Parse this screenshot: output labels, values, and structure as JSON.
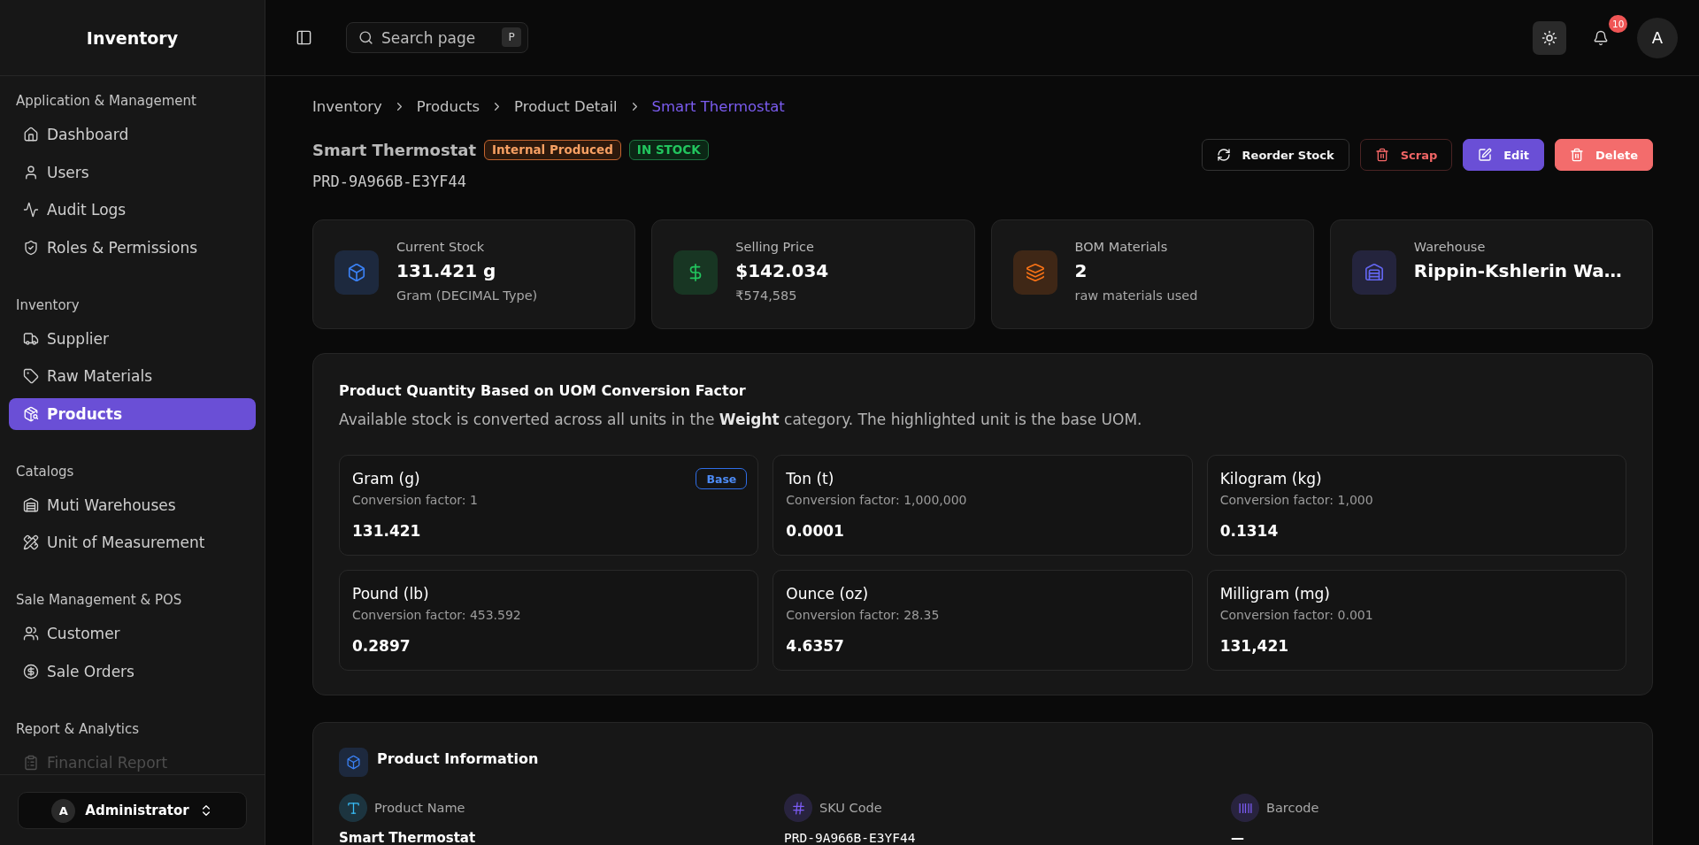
{
  "sidebar": {
    "title": "Inventory",
    "sections": [
      {
        "label": "Application & Management",
        "items": [
          {
            "label": "Dashboard",
            "selected": false,
            "disabled": false
          },
          {
            "label": "Users",
            "selected": false,
            "disabled": false
          },
          {
            "label": "Audit Logs",
            "selected": false,
            "disabled": false
          },
          {
            "label": "Roles & Permissions",
            "selected": false,
            "disabled": false
          }
        ]
      },
      {
        "label": "Inventory",
        "items": [
          {
            "label": "Supplier",
            "selected": false,
            "disabled": false
          },
          {
            "label": "Raw Materials",
            "selected": false,
            "disabled": false
          },
          {
            "label": "Products",
            "selected": true,
            "disabled": false
          }
        ]
      },
      {
        "label": "Catalogs",
        "items": [
          {
            "label": "Muti Warehouses",
            "selected": false,
            "disabled": false
          },
          {
            "label": "Unit of Measurement",
            "selected": false,
            "disabled": false
          }
        ]
      },
      {
        "label": "Sale Management & POS",
        "items": [
          {
            "label": "Customer",
            "selected": false,
            "disabled": false
          },
          {
            "label": "Sale Orders",
            "selected": false,
            "disabled": false
          }
        ]
      },
      {
        "label": "Report & Analytics",
        "items": [
          {
            "label": "Financial Report",
            "selected": false,
            "disabled": true
          }
        ]
      }
    ],
    "user": {
      "avatar": "A",
      "name": "Administrator"
    }
  },
  "topbar": {
    "search": {
      "placeholder": "Search page",
      "shortcut": "P"
    },
    "notification_count": "10",
    "avatar": "A"
  },
  "breadcrumb": [
    {
      "label": "Inventory",
      "current": false
    },
    {
      "label": "Products",
      "current": false
    },
    {
      "label": "Product Detail",
      "current": false
    },
    {
      "label": "Smart Thermostat",
      "current": true
    }
  ],
  "product": {
    "name": "Smart Thermostat",
    "badges": [
      {
        "label": "Internal Produced",
        "kind": "warning"
      },
      {
        "label": "IN STOCK",
        "kind": "success"
      }
    ],
    "sku": "PRD-9A966B-E3YF44"
  },
  "actions": [
    {
      "label": "Reorder Stock",
      "kind": "outline"
    },
    {
      "label": "Scrap",
      "kind": "danger-outline"
    },
    {
      "label": "Edit",
      "kind": "primary"
    },
    {
      "label": "Delete",
      "kind": "danger"
    }
  ],
  "stats": [
    {
      "label": "Current Stock",
      "value": "131.421 g",
      "sub": "Gram (DECIMAL Type)",
      "color": "#3b82f6"
    },
    {
      "label": "Selling Price",
      "value": "$142.034",
      "sub": "₹574,585",
      "color": "#22c55e"
    },
    {
      "label": "BOM Materials",
      "value": "2",
      "sub": "raw materials used",
      "color": "#f97316"
    },
    {
      "label": "Warehouse",
      "value": "Rippin-Kshlerin Wa…",
      "color": "#6366f1"
    }
  ],
  "uom": {
    "title": "Product Quantity Based on UOM Conversion Factor",
    "description": "Available stock is converted across all units in the **Weight** category. The highlighted unit is the base UOM.",
    "base_label": "Base",
    "units": [
      {
        "name": "Gram (g)",
        "factor": "Conversion factor: 1",
        "value": "131.421",
        "base": true
      },
      {
        "name": "Ton (t)",
        "factor": "Conversion factor: 1,000,000",
        "value": "0.0001",
        "base": false
      },
      {
        "name": "Kilogram (kg)",
        "factor": "Conversion factor: 1,000",
        "value": "0.1314",
        "base": false
      },
      {
        "name": "Pound (lb)",
        "factor": "Conversion factor: 453.592",
        "value": "0.2897",
        "base": false
      },
      {
        "name": "Ounce (oz)",
        "factor": "Conversion factor: 28.35",
        "value": "4.6357",
        "base": false
      },
      {
        "name": "Milligram (mg)",
        "factor": "Conversion factor: 0.001",
        "value": "131,421",
        "base": false
      }
    ]
  },
  "product_information": {
    "title": "Product Information",
    "fields": [
      {
        "label": "Product Name",
        "value": "Smart Thermostat",
        "kind": "text",
        "color": "#38bdf8"
      },
      {
        "label": "SKU Code",
        "value": "PRD-9A966B-E3YF44",
        "kind": "code",
        "color": "#7c5cf6"
      },
      {
        "label": "Barcode",
        "value": "—",
        "kind": "text",
        "color": "#7c5cf6"
      }
    ]
  }
}
